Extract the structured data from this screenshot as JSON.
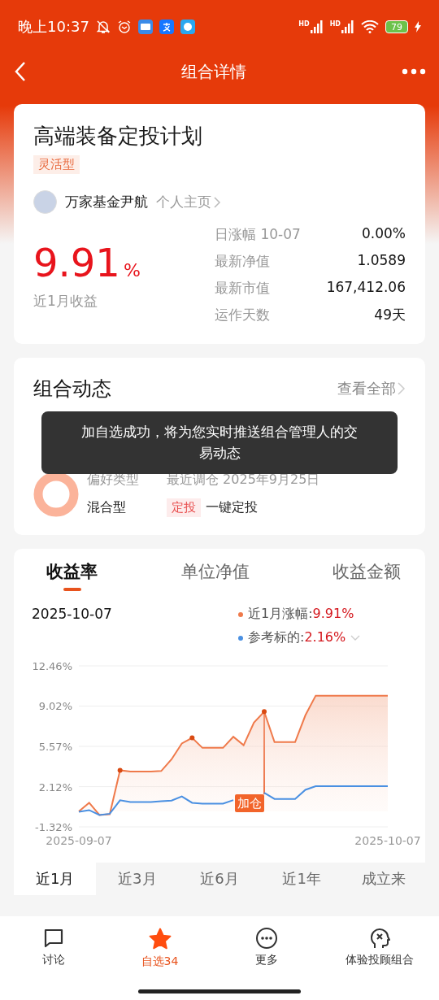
{
  "status_bar": {
    "time": "晚上10:37",
    "signal_labels": [
      "HD",
      "HD"
    ],
    "battery": "79"
  },
  "header": {
    "title": "组合详情"
  },
  "plan": {
    "title": "高端装备定投计划",
    "tag": "灵活型",
    "manager": "万家基金尹航",
    "profile_link": "个人主页",
    "return_value": "9.91",
    "return_unit": "%",
    "return_label": "近1月收益",
    "stats": [
      {
        "label": "日涨幅 10-07",
        "value": "0.00%"
      },
      {
        "label": "最新净值",
        "value": "1.0589"
      },
      {
        "label": "最新市值",
        "value": "167,412.06"
      },
      {
        "label": "运作天数",
        "value": "49天"
      }
    ]
  },
  "dynamics": {
    "title": "组合动态",
    "view_all": "查看全部",
    "pref_label": "偏好类型",
    "pref_value": "混合型",
    "rebalance_label": "最近调仓 2025年9月25日",
    "action_tag": "定投",
    "action": "一键定投"
  },
  "toast": {
    "text": "加自选成功，将为您实时推送组合管理人的交易动态"
  },
  "performance": {
    "tabs": [
      {
        "label": "收益率",
        "selected": true
      },
      {
        "label": "单位净值",
        "selected": false
      },
      {
        "label": "收益金额",
        "selected": false
      }
    ],
    "date": "2025-10-07",
    "legend": [
      {
        "separator": ":",
        "value": "9.91%",
        "expandable": false
      },
      {
        "separator": ":",
        "value": "2.16%",
        "expandable": true
      }
    ],
    "chart_data": {
      "type": "line",
      "grid": true,
      "categories": [
        "2025-09-07",
        null,
        null,
        null,
        null,
        null,
        null,
        null,
        null,
        null,
        null,
        null,
        null,
        null,
        null,
        null,
        null,
        null,
        null,
        null,
        null,
        null,
        null,
        null,
        null,
        null,
        null,
        null,
        null,
        null,
        "2025-10-07"
      ],
      "series": [
        {
          "name": "近1月涨幅",
          "color": "#ef7a4b",
          "type": "area",
          "values": [
            0.0,
            0.74,
            -0.31,
            -0.24,
            3.52,
            3.42,
            3.42,
            3.42,
            3.46,
            4.46,
            5.82,
            6.3,
            5.44,
            5.44,
            5.44,
            6.39,
            5.67,
            7.6,
            8.54,
            5.93,
            5.93,
            5.93,
            8.23,
            9.91,
            9.91,
            9.91,
            9.91,
            9.91,
            9.91,
            9.91,
            9.91
          ]
        },
        {
          "name": "参考标的",
          "color": "#4a90e2",
          "values": [
            -0.03,
            0.11,
            -0.31,
            -0.2,
            0.95,
            0.8,
            0.8,
            0.8,
            0.87,
            0.93,
            1.28,
            0.74,
            0.66,
            0.66,
            0.66,
            0.97,
            null,
            null,
            1.6,
            1.07,
            1.07,
            1.07,
            1.85,
            2.16,
            2.16,
            2.16,
            2.16,
            2.16,
            2.16,
            2.16,
            2.16
          ]
        }
      ],
      "ylim": [
        -1.32,
        12.46
      ],
      "yticks": [
        {
          "value": 12.46,
          "label": "12.46%"
        },
        {
          "value": 9.02,
          "label": "9.02%"
        },
        {
          "value": 5.57,
          "label": "5.57%"
        },
        {
          "value": 2.12,
          "label": "2.12%"
        },
        {
          "value": -1.32,
          "label": "-1.32%"
        }
      ],
      "annotations": [
        "加仓"
      ]
    },
    "periods": [
      {
        "label": "近1月",
        "selected": true
      },
      {
        "label": "近3月",
        "selected": false
      },
      {
        "label": "近6月",
        "selected": false
      },
      {
        "label": "近1年",
        "selected": false
      },
      {
        "label": "成立来",
        "selected": false
      }
    ]
  },
  "bottom_nav": [
    {
      "kind": "chat",
      "label": "讨论",
      "selected": false
    },
    {
      "kind": "star",
      "label": "自选34",
      "selected": true
    },
    {
      "kind": "more",
      "label": "更多",
      "selected": false
    },
    {
      "kind": "advisor",
      "label": "体验投顾组合",
      "selected": false
    }
  ]
}
